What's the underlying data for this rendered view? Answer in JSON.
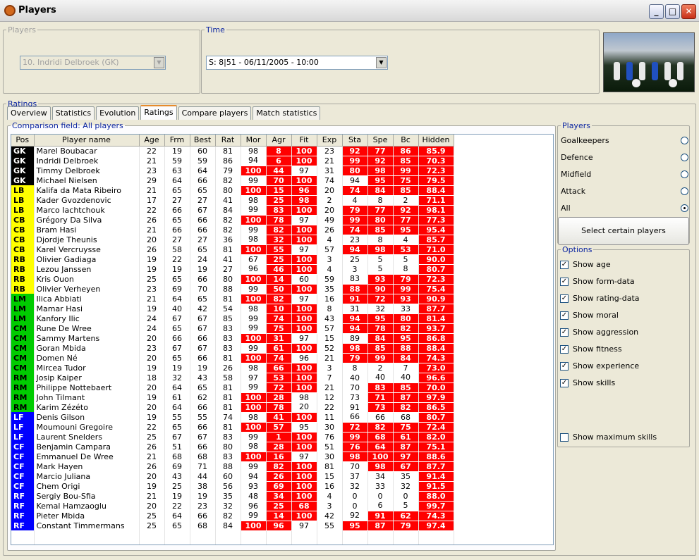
{
  "window": {
    "title": "Players"
  },
  "players_group": {
    "legend": "Players",
    "selected": "10. Indridi Delbroek (GK)"
  },
  "time_group": {
    "legend": "Time",
    "selected": "S: 8|51 - 06/11/2005 - 10:00"
  },
  "ratings_label": "Ratings",
  "tabs": [
    "Overview",
    "Statistics",
    "Evolution",
    "Ratings",
    "Compare players",
    "Match statistics"
  ],
  "active_tab": "Ratings",
  "comparison_label": "Comparison field: All players",
  "columns": [
    "Pos",
    "Player name",
    "Age",
    "Frm",
    "Best",
    "Rat",
    "Mor",
    "Agr",
    "Fit",
    "Exp",
    "Sta",
    "Spe",
    "Bc",
    "Hidden"
  ],
  "highlight_color": "#ff0000",
  "rows": [
    [
      "GK",
      "Marel Boubacar",
      "22",
      "19",
      "60",
      "81",
      "98",
      "8",
      "100",
      "23",
      "92",
      "77",
      "86",
      "85.9"
    ],
    [
      "GK",
      "Indridi Delbroek",
      "21",
      "59",
      "59",
      "86",
      "94",
      "6",
      "100",
      "21",
      "99",
      "92",
      "85",
      "70.3"
    ],
    [
      "GK",
      "Timmy Delbroek",
      "23",
      "63",
      "64",
      "79",
      "100",
      "44",
      "97",
      "31",
      "80",
      "98",
      "99",
      "72.3"
    ],
    [
      "GK",
      "Michael Nielsen",
      "29",
      "64",
      "66",
      "82",
      "99",
      "70",
      "100",
      "74",
      "94",
      "95",
      "75",
      "79.5"
    ],
    [
      "LB",
      "Kalifa da Mata Ribeiro",
      "21",
      "65",
      "65",
      "80",
      "100",
      "15",
      "96",
      "20",
      "74",
      "84",
      "85",
      "88.4"
    ],
    [
      "LB",
      "Kader Gvozdenovic",
      "17",
      "27",
      "27",
      "41",
      "98",
      "25",
      "98",
      "2",
      "4",
      "8",
      "2",
      "71.1"
    ],
    [
      "LB",
      "Marco Iachtchouk",
      "22",
      "66",
      "67",
      "84",
      "99",
      "83",
      "100",
      "20",
      "79",
      "77",
      "92",
      "98.1"
    ],
    [
      "CB",
      "Grégory Da Silva",
      "26",
      "65",
      "66",
      "82",
      "100",
      "78",
      "97",
      "49",
      "99",
      "80",
      "77",
      "77.3"
    ],
    [
      "CB",
      "Bram Hasi",
      "21",
      "66",
      "66",
      "82",
      "99",
      "82",
      "100",
      "26",
      "74",
      "85",
      "95",
      "95.4"
    ],
    [
      "CB",
      "Djordje Theunis",
      "20",
      "27",
      "27",
      "36",
      "98",
      "32",
      "100",
      "4",
      "23",
      "8",
      "4",
      "85.7"
    ],
    [
      "CB",
      "Karel Vercruysse",
      "26",
      "58",
      "65",
      "81",
      "100",
      "55",
      "97",
      "57",
      "94",
      "98",
      "53",
      "71.0"
    ],
    [
      "RB",
      "Olivier Gadiaga",
      "19",
      "22",
      "24",
      "41",
      "67",
      "25",
      "100",
      "3",
      "25",
      "5",
      "5",
      "90.0"
    ],
    [
      "RB",
      "Lezou Janssen",
      "19",
      "19",
      "19",
      "27",
      "96",
      "46",
      "100",
      "4",
      "3",
      "5",
      "8",
      "80.7"
    ],
    [
      "RB",
      "Kris Ouon",
      "25",
      "65",
      "66",
      "80",
      "100",
      "14",
      "60",
      "59",
      "83",
      "93",
      "79",
      "72.3"
    ],
    [
      "RB",
      "Olivier Verheyen",
      "23",
      "69",
      "70",
      "88",
      "99",
      "50",
      "100",
      "35",
      "88",
      "90",
      "99",
      "75.4"
    ],
    [
      "LM",
      "Ilica Abbiati",
      "21",
      "64",
      "65",
      "81",
      "100",
      "82",
      "97",
      "16",
      "91",
      "72",
      "93",
      "90.9"
    ],
    [
      "LM",
      "Mamar Hasi",
      "19",
      "40",
      "42",
      "54",
      "98",
      "10",
      "100",
      "8",
      "31",
      "32",
      "33",
      "87.7"
    ],
    [
      "LM",
      "Kanfory Ilic",
      "24",
      "67",
      "67",
      "85",
      "99",
      "74",
      "100",
      "43",
      "94",
      "95",
      "80",
      "81.4"
    ],
    [
      "CM",
      "Rune De Wree",
      "24",
      "65",
      "67",
      "83",
      "99",
      "75",
      "100",
      "57",
      "94",
      "78",
      "82",
      "93.7"
    ],
    [
      "CM",
      "Sammy Martens",
      "20",
      "66",
      "66",
      "83",
      "100",
      "31",
      "97",
      "15",
      "89",
      "84",
      "95",
      "86.8"
    ],
    [
      "CM",
      "Goran Mbida",
      "23",
      "67",
      "67",
      "83",
      "99",
      "61",
      "100",
      "52",
      "98",
      "85",
      "88",
      "88.4"
    ],
    [
      "CM",
      "Domen Né",
      "20",
      "65",
      "66",
      "81",
      "100",
      "74",
      "96",
      "21",
      "79",
      "99",
      "84",
      "74.3"
    ],
    [
      "CM",
      "Mircea Tudor",
      "19",
      "19",
      "19",
      "26",
      "98",
      "66",
      "100",
      "3",
      "8",
      "2",
      "7",
      "73.0"
    ],
    [
      "RM",
      "Josip Kaiper",
      "18",
      "32",
      "43",
      "58",
      "97",
      "53",
      "100",
      "7",
      "40",
      "40",
      "40",
      "96.6"
    ],
    [
      "RM",
      "Philippe Nottebaert",
      "20",
      "64",
      "65",
      "81",
      "99",
      "72",
      "100",
      "21",
      "70",
      "83",
      "85",
      "70.0"
    ],
    [
      "RM",
      "John Tilmant",
      "19",
      "61",
      "62",
      "81",
      "100",
      "28",
      "98",
      "12",
      "73",
      "71",
      "87",
      "97.9"
    ],
    [
      "RM",
      "Karim Zézéto",
      "20",
      "64",
      "66",
      "81",
      "100",
      "78",
      "20",
      "22",
      "91",
      "73",
      "82",
      "86.5"
    ],
    [
      "LF",
      "Denis Gilson",
      "19",
      "55",
      "55",
      "74",
      "98",
      "41",
      "100",
      "11",
      "66",
      "66",
      "68",
      "80.7"
    ],
    [
      "LF",
      "Moumouni Gregoire",
      "22",
      "65",
      "66",
      "81",
      "100",
      "57",
      "95",
      "30",
      "72",
      "82",
      "75",
      "72.4"
    ],
    [
      "LF",
      "Laurent Snelders",
      "25",
      "67",
      "67",
      "83",
      "99",
      "1",
      "100",
      "76",
      "99",
      "68",
      "61",
      "82.0"
    ],
    [
      "CF",
      "Benjamin Campara",
      "26",
      "51",
      "66",
      "80",
      "98",
      "28",
      "100",
      "51",
      "76",
      "64",
      "87",
      "75.1"
    ],
    [
      "CF",
      "Emmanuel De Wree",
      "21",
      "68",
      "68",
      "83",
      "100",
      "16",
      "97",
      "30",
      "98",
      "100",
      "97",
      "88.6"
    ],
    [
      "CF",
      "Mark Hayen",
      "26",
      "69",
      "71",
      "88",
      "99",
      "82",
      "100",
      "81",
      "70",
      "98",
      "67",
      "87.7"
    ],
    [
      "CF",
      "Marcio Juliana",
      "20",
      "43",
      "44",
      "60",
      "94",
      "26",
      "100",
      "15",
      "37",
      "34",
      "35",
      "91.4"
    ],
    [
      "CF",
      "Chem Origi",
      "19",
      "25",
      "38",
      "56",
      "93",
      "69",
      "100",
      "16",
      "32",
      "33",
      "32",
      "91.5"
    ],
    [
      "RF",
      "Sergiy Bou-Sfia",
      "21",
      "19",
      "19",
      "35",
      "48",
      "34",
      "100",
      "4",
      "0",
      "0",
      "0",
      "88.0"
    ],
    [
      "RF",
      "Kemal Hamzaoglu",
      "20",
      "22",
      "23",
      "32",
      "96",
      "25",
      "68",
      "3",
      "0",
      "6",
      "5",
      "99.7"
    ],
    [
      "RF",
      "Pieter Mbida",
      "25",
      "64",
      "66",
      "82",
      "99",
      "14",
      "100",
      "42",
      "92",
      "91",
      "62",
      "74.3"
    ],
    [
      "RF",
      "Constant Timmermans",
      "25",
      "65",
      "68",
      "84",
      "100",
      "96",
      "97",
      "55",
      "95",
      "87",
      "79",
      "97.4"
    ]
  ],
  "highlight_cells": [
    [
      7,
      8,
      10,
      11,
      12,
      13
    ],
    [
      7,
      8,
      10,
      11,
      12,
      13
    ],
    [
      6,
      7,
      10,
      11,
      12,
      13
    ],
    [
      7,
      8,
      11,
      12,
      13
    ],
    [
      6,
      7,
      8,
      10,
      11,
      12,
      13
    ],
    [
      7,
      8,
      13
    ],
    [
      7,
      8,
      10,
      11,
      12,
      13
    ],
    [
      6,
      7,
      10,
      11,
      12,
      13
    ],
    [
      7,
      8,
      10,
      11,
      12,
      13
    ],
    [
      7,
      8,
      13
    ],
    [
      6,
      7,
      10,
      11,
      12,
      13
    ],
    [
      7,
      8,
      13
    ],
    [
      7,
      8,
      13
    ],
    [
      6,
      7,
      11,
      12,
      13
    ],
    [
      7,
      8,
      10,
      11,
      12,
      13
    ],
    [
      6,
      7,
      10,
      11,
      12,
      13
    ],
    [
      7,
      8,
      13
    ],
    [
      7,
      8,
      10,
      11,
      12,
      13
    ],
    [
      7,
      8,
      10,
      11,
      12,
      13
    ],
    [
      6,
      7,
      11,
      12,
      13
    ],
    [
      7,
      8,
      10,
      11,
      12,
      13
    ],
    [
      6,
      7,
      10,
      11,
      12,
      13
    ],
    [
      7,
      8,
      13
    ],
    [
      7,
      8,
      13
    ],
    [
      7,
      8,
      11,
      12,
      13
    ],
    [
      6,
      7,
      11,
      12,
      13
    ],
    [
      6,
      7,
      11,
      12,
      13
    ],
    [
      7,
      8,
      13
    ],
    [
      6,
      7,
      10,
      11,
      12,
      13
    ],
    [
      7,
      8,
      10,
      11,
      12,
      13
    ],
    [
      7,
      8,
      10,
      11,
      12,
      13
    ],
    [
      6,
      7,
      10,
      11,
      12,
      13
    ],
    [
      7,
      8,
      11,
      12,
      13
    ],
    [
      7,
      8,
      13
    ],
    [
      7,
      8,
      13
    ],
    [
      7,
      8,
      13
    ],
    [
      7,
      8,
      13
    ],
    [
      7,
      8,
      11,
      12,
      13
    ],
    [
      6,
      7,
      10,
      11,
      12,
      13
    ]
  ],
  "side_players": {
    "legend": "Players",
    "options": [
      "Goalkeepers",
      "Defence",
      "Midfield",
      "Attack",
      "All"
    ],
    "selected": "All"
  },
  "select_button": "Select certain players",
  "options": {
    "legend": "Options",
    "items": [
      "Show age",
      "Show form-data",
      "Show rating-data",
      "Show moral",
      "Show aggression",
      "Show fitness",
      "Show experience",
      "Show skills"
    ],
    "max_skills": "Show maximum skills"
  }
}
